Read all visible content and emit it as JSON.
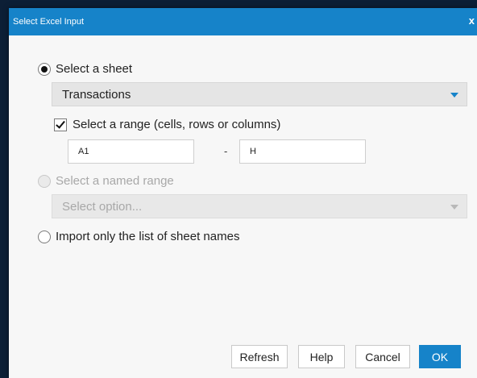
{
  "dialog": {
    "title": "Select Excel Input",
    "close_label": "x"
  },
  "sheet_option": {
    "label": "Select a sheet",
    "selected": true,
    "dropdown_value": "Transactions"
  },
  "range_option": {
    "label": "Select a range (cells, rows or columns)",
    "checked": true,
    "from_value": "A1",
    "separator": "-",
    "to_value": "H"
  },
  "named_range_option": {
    "label": "Select a named range",
    "enabled": false,
    "dropdown_placeholder": "Select option..."
  },
  "sheet_names_option": {
    "label": "Import only the list of sheet names",
    "selected": false
  },
  "buttons": {
    "refresh": "Refresh",
    "help": "Help",
    "cancel": "Cancel",
    "ok": "OK"
  },
  "colors": {
    "accent": "#1683c9",
    "backdrop": "#0c1f36"
  },
  "icons": {
    "close": "close-icon",
    "dropdown": "chevron-down-icon"
  }
}
